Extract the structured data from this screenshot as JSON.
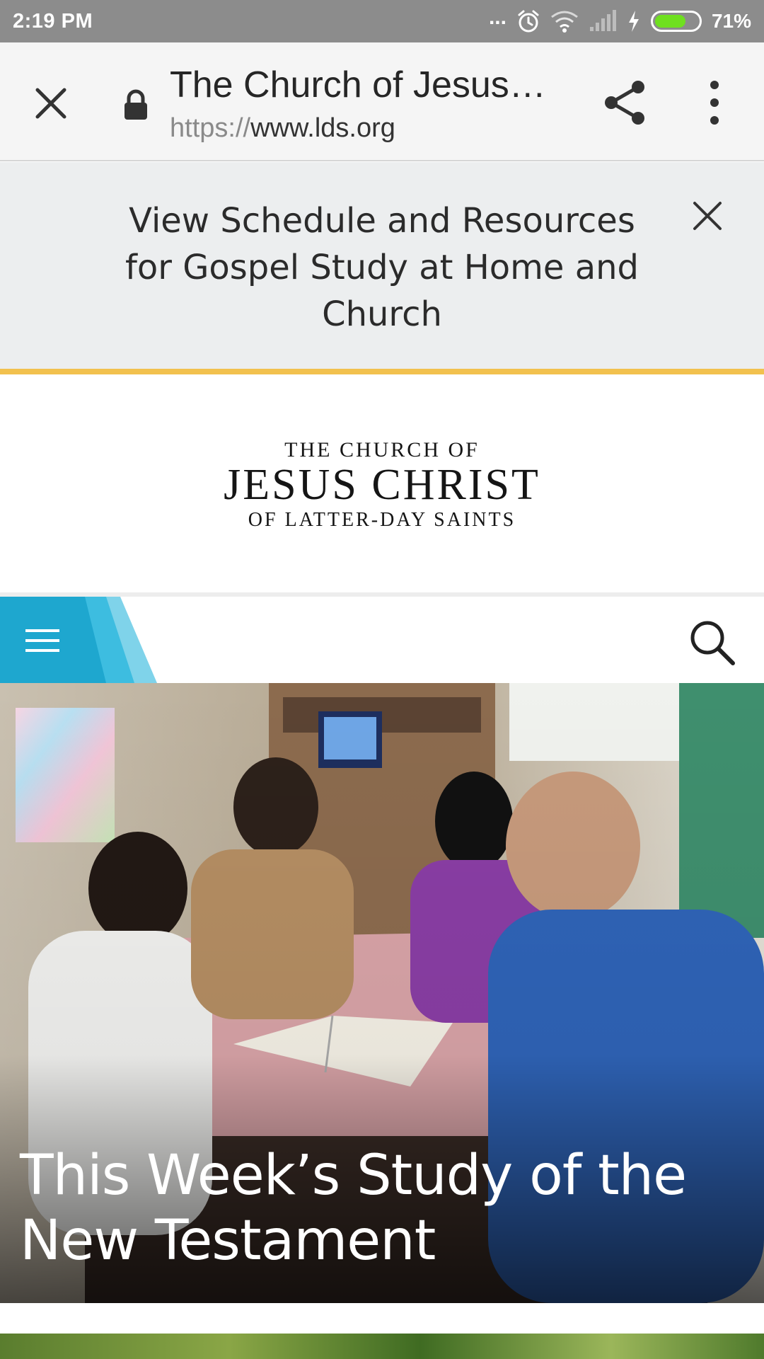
{
  "status_bar": {
    "time": "2:19 PM",
    "dots": "...",
    "battery_percent": "71%",
    "battery_level": 0.71,
    "icons": [
      "alarm-icon",
      "wifi-icon",
      "signal-icon",
      "charging-icon",
      "battery-icon"
    ]
  },
  "toolbar": {
    "title": "The Church of Jesus…",
    "url_scheme": "https://",
    "url_host": "www.lds.org",
    "icons": [
      "close-icon",
      "lock-icon",
      "share-icon",
      "more-vert-icon"
    ]
  },
  "banner": {
    "text": "View Schedule and Resources for Gospel Study at Home and Church",
    "accent_color": "#f2c14e",
    "icons": [
      "close-icon"
    ]
  },
  "logo": {
    "line1": "THE CHURCH OF",
    "line2": "JESUS CHRIST",
    "line3": "OF LATTER-DAY SAINTS"
  },
  "navbar": {
    "accent_color": "#1ea7cf",
    "icons": [
      "menu-icon",
      "search-icon"
    ]
  },
  "hero": {
    "title": "This Week’s Study of the New Testament"
  }
}
